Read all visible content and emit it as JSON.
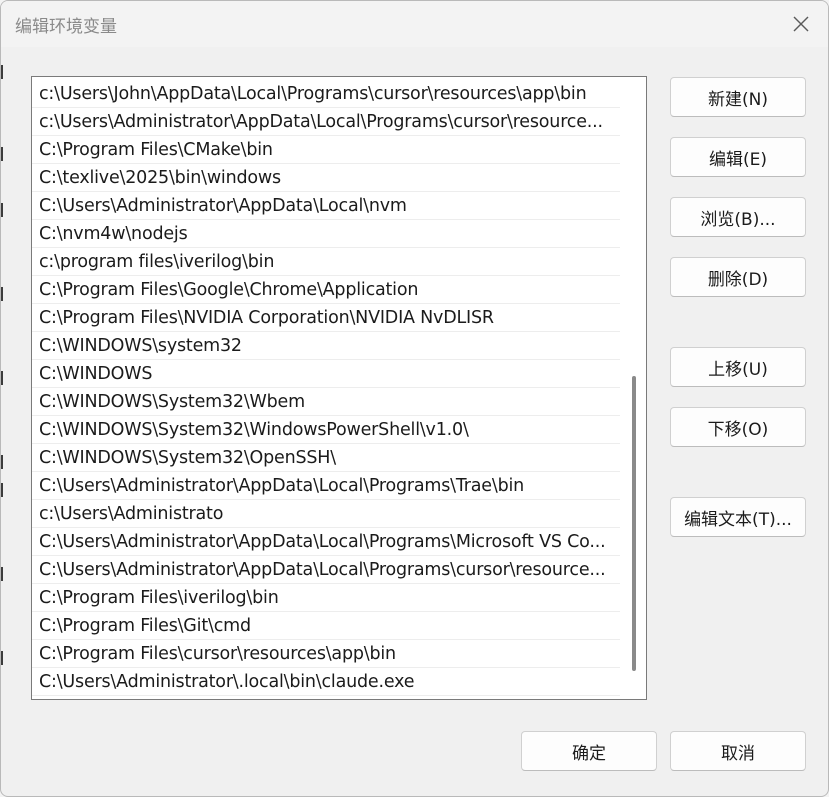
{
  "window": {
    "title": "编辑环境变量"
  },
  "paths": [
    "c:\\Users\\John\\AppData\\Local\\Programs\\cursor\\resources\\app\\bin",
    "c:\\Users\\Administrator\\AppData\\Local\\Programs\\cursor\\resource...",
    "C:\\Program Files\\CMake\\bin",
    "C:\\texlive\\2025\\bin\\windows",
    "C:\\Users\\Administrator\\AppData\\Local\\nvm",
    "C:\\nvm4w\\nodejs",
    "c:\\program files\\iverilog\\bin",
    "C:\\Program Files\\Google\\Chrome\\Application",
    "C:\\Program Files\\NVIDIA Corporation\\NVIDIA NvDLISR",
    "C:\\WINDOWS\\system32",
    "C:\\WINDOWS",
    "C:\\WINDOWS\\System32\\Wbem",
    "C:\\WINDOWS\\System32\\WindowsPowerShell\\v1.0\\",
    "C:\\WINDOWS\\System32\\OpenSSH\\",
    "C:\\Users\\Administrator\\AppData\\Local\\Programs\\Trae\\bin",
    "c:\\Users\\Administrato",
    "C:\\Users\\Administrator\\AppData\\Local\\Programs\\Microsoft VS Co...",
    "C:\\Users\\Administrator\\AppData\\Local\\Programs\\cursor\\resource...",
    "C:\\Program Files\\iverilog\\bin",
    "C:\\Program Files\\Git\\cmd",
    "C:\\Program Files\\cursor\\resources\\app\\bin",
    "C:\\Users\\Administrator\\.local\\bin\\claude.exe"
  ],
  "scrollbar": {
    "thumb_start_fraction": 0.48,
    "thumb_end_fraction": 0.955
  },
  "buttons": {
    "new": "新建(N)",
    "edit": "编辑(E)",
    "browse": "浏览(B)...",
    "delete": "删除(D)",
    "move_up": "上移(U)",
    "move_down": "下移(O)",
    "edit_text": "编辑文本(T)...",
    "ok": "确定",
    "cancel": "取消"
  },
  "icons": {
    "close": "close-icon"
  }
}
